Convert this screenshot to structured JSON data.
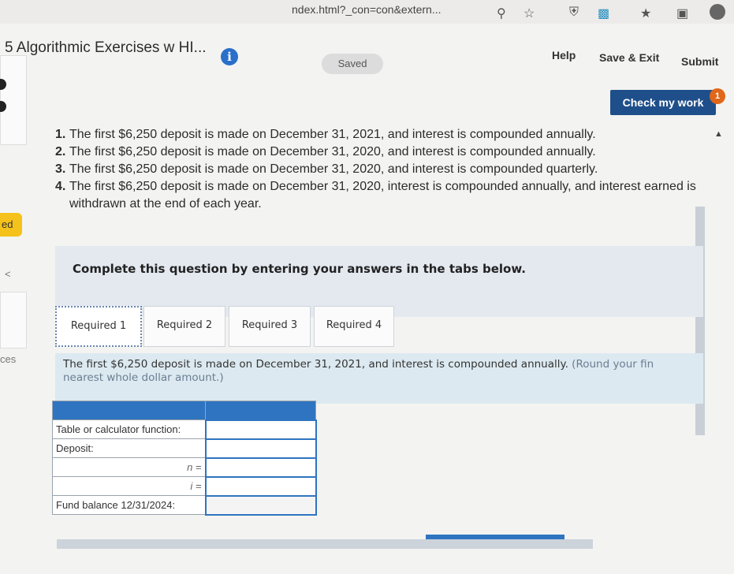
{
  "browser": {
    "url_fragment": "ndex.html?_con=con&extern...",
    "icons": [
      "zoom-icon",
      "star-icon",
      "extension-icon",
      "shield-icon",
      "favorites-icon",
      "collections-icon",
      "profile-icon"
    ]
  },
  "header": {
    "title": "5 Algorithmic Exercises w HI...",
    "info_label": "i",
    "saved_label": "Saved",
    "help_label": "Help",
    "save_exit_label": "Save & Exit",
    "submit_label": "Submit"
  },
  "left_strip": {
    "tab_label": "ed",
    "item_label": "ces",
    "arrow_label": "<"
  },
  "check": {
    "label": "Check my work",
    "badge": "1"
  },
  "question": {
    "items": [
      {
        "num": "1.",
        "text": "The first $6,250 deposit is made on December 31, 2021, and interest is compounded annually."
      },
      {
        "num": "2.",
        "text": "The first $6,250 deposit is made on December 31, 2020, and interest is compounded annually."
      },
      {
        "num": "3.",
        "text": "The first $6,250 deposit is made on December 31, 2020, and interest is compounded quarterly."
      },
      {
        "num": "4.",
        "text": "The first $6,250 deposit is made on December 31, 2020, interest is compounded annually, and interest earned is withdrawn at the end of each year."
      }
    ]
  },
  "instructions": "Complete this question by entering your answers in the tabs below.",
  "tabs": [
    {
      "label": "Required 1",
      "active": true
    },
    {
      "label": "Required 2",
      "active": false
    },
    {
      "label": "Required 3",
      "active": false
    },
    {
      "label": "Required 4",
      "active": false
    }
  ],
  "requirement": {
    "text": "The first $6,250 deposit is made on December 31, 2021, and interest is compounded annually.",
    "note": "(Round your fin",
    "note_cont": "nearest whole dollar amount.)"
  },
  "table": {
    "rows": [
      {
        "label": "Table or calculator function:",
        "value": ""
      },
      {
        "label": "Deposit:",
        "value": ""
      },
      {
        "label": "n =",
        "value": ""
      },
      {
        "label": "i =",
        "value": ""
      },
      {
        "label": "Fund balance 12/31/2024:",
        "value": ""
      }
    ]
  },
  "colors": {
    "accent": "#2f74c0",
    "check_button": "#1f4f8a",
    "badge": "#e06619",
    "tab_marker": "#f5c21b"
  }
}
